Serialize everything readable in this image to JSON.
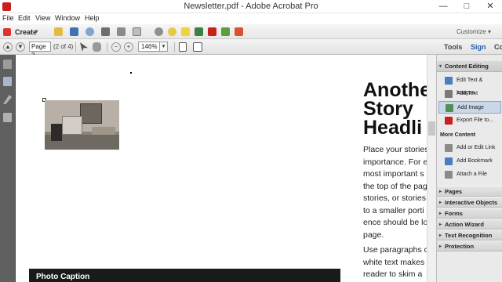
{
  "window": {
    "title": "Newsletter.pdf - Adobe Acrobat Pro",
    "minimize_glyph": "—",
    "maximize_glyph": "□",
    "close_glyph": "✕"
  },
  "menu": {
    "items": [
      "File",
      "Edit",
      "View",
      "Window",
      "Help"
    ]
  },
  "toolbar": {
    "create_label": "Create",
    "create_caret": "▾",
    "customize_label": "Customize",
    "customize_caret": "▾",
    "icons": [
      "open-folder-icon",
      "save-icon",
      "cloud-icon",
      "print-icon",
      "edit-icon",
      "email-icon",
      "settings-icon",
      "comment-icon",
      "stamp-icon",
      "sign-icon",
      "redact-icon",
      "export-icon",
      "review-icon"
    ]
  },
  "navbar": {
    "page_value": "Page 2",
    "page_of": "(2 of 4)",
    "zoom_value": "146%",
    "zoom_caret": "▾",
    "prev_glyph": "▲",
    "next_glyph": "▼",
    "zoom_out_glyph": "−",
    "zoom_in_glyph": "+",
    "tabs": {
      "tools": "Tools",
      "sign": "Sign",
      "comment": "Co"
    }
  },
  "document": {
    "headline_lines": [
      "Anothe",
      "Story",
      "Headli"
    ],
    "body_lines_1": [
      "Place your stories",
      "importance. For e",
      "most important s",
      "the top of the pag",
      "stories, or stories",
      "to a smaller porti",
      "ence should be lo",
      "page."
    ],
    "body_lines_2": [
      "Use paragraphs o",
      "white text makes",
      "reader to skim a"
    ],
    "caption": "Photo Caption"
  },
  "right_panel": {
    "content_editing": {
      "title": "Content Editing",
      "items": [
        {
          "label": "Edit Text & Images",
          "color": "#4a7fbf"
        },
        {
          "label": "Add Text",
          "color": "#7a7a7a"
        },
        {
          "label": "Add Image",
          "color": "#4f8f4f",
          "active": true
        },
        {
          "label": "Export File to...",
          "color": "#c8201c"
        }
      ]
    },
    "more_content": {
      "title": "More Content",
      "items": [
        {
          "label": "Add or Edit Link",
          "color": "#8a8a8a"
        },
        {
          "label": "Add Bookmark",
          "color": "#4a7fbf"
        },
        {
          "label": "Attach a File",
          "color": "#8a8a8a"
        }
      ]
    },
    "sections": [
      "Pages",
      "Interactive Objects",
      "Forms",
      "Action Wizard",
      "Text Recognition",
      "Protection"
    ],
    "open_glyph": "▾",
    "closed_glyph": "▸"
  },
  "colors": {
    "caption_bg": "#1a1a1a",
    "left_panel": "#5f5f5f",
    "sign_tab": "#1f5ea8"
  }
}
